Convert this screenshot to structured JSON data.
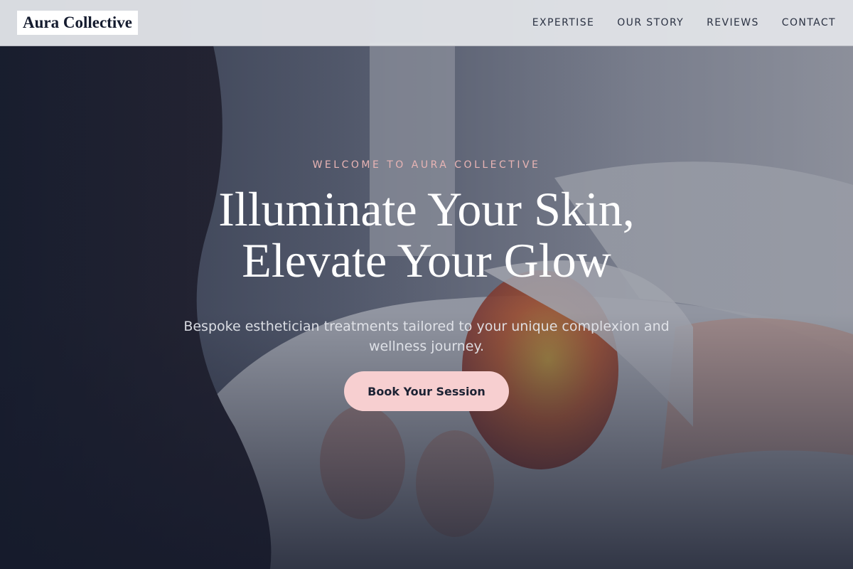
{
  "brand": {
    "name": "Aura Collective"
  },
  "nav": {
    "items": [
      {
        "label": "EXPERTISE"
      },
      {
        "label": "OUR STORY"
      },
      {
        "label": "REVIEWS"
      },
      {
        "label": "CONTACT"
      }
    ]
  },
  "hero": {
    "eyebrow": "WELCOME TO AURA COLLECTIVE",
    "headline_line1": "Illuminate Your Skin,",
    "headline_line2": "Elevate Your Glow",
    "subheadline": "Bespoke esthetician treatments tailored to your unique complexion and wellness journey.",
    "cta_label": "Book Your Session",
    "background_image": "esthetician-led-face-mask-treatment-photo"
  },
  "colors": {
    "accent_pink": "#f7cfd0",
    "eyebrow_pink": "#e8b4b4",
    "navy": "#1c2233",
    "header_bg": "#e2e4e8"
  }
}
